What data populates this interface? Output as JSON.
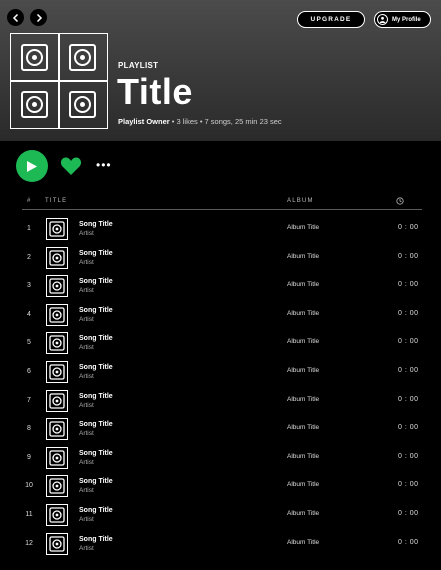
{
  "nav": {
    "back_icon": "chevron-left-icon",
    "forward_icon": "chevron-right-icon"
  },
  "top_bar": {
    "upgrade_label": "UPGRADE",
    "profile_label": "My Profile",
    "profile_icon": "user-icon"
  },
  "playlist": {
    "type_label": "PLAYLIST",
    "title": "Title",
    "owner": "Playlist Owner",
    "meta": " • 3 likes • 7 songs, 25 min 23 sec"
  },
  "controls": {
    "play_icon": "play-icon",
    "like_icon": "heart-icon",
    "more_label": "•••"
  },
  "table": {
    "headers": {
      "number": "#",
      "title": "TITLE",
      "album": "ALBUM",
      "duration_icon": "clock-icon"
    },
    "rows": [
      {
        "num": "1",
        "title": "Song Title",
        "artist": "Artist",
        "album": "Album Title",
        "duration": "0 : 00"
      },
      {
        "num": "2",
        "title": "Song Title",
        "artist": "Artist",
        "album": "Album Title",
        "duration": "0 : 00"
      },
      {
        "num": "3",
        "title": "Song Title",
        "artist": "Artist",
        "album": "Album Title",
        "duration": "0 : 00"
      },
      {
        "num": "4",
        "title": "Song Title",
        "artist": "Artist",
        "album": "Album Title",
        "duration": "0 : 00"
      },
      {
        "num": "5",
        "title": "Song Title",
        "artist": "Artist",
        "album": "Album Title",
        "duration": "0 : 00"
      },
      {
        "num": "6",
        "title": "Song Title",
        "artist": "Artist",
        "album": "Album Title",
        "duration": "0 : 00"
      },
      {
        "num": "7",
        "title": "Song Title",
        "artist": "Artist",
        "album": "Album Title",
        "duration": "0 : 00"
      },
      {
        "num": "8",
        "title": "Song Title",
        "artist": "Artist",
        "album": "Album Title",
        "duration": "0 : 00"
      },
      {
        "num": "9",
        "title": "Song Title",
        "artist": "Artist",
        "album": "Album Title",
        "duration": "0 : 00"
      },
      {
        "num": "10",
        "title": "Song Title",
        "artist": "Artist",
        "album": "Album Title",
        "duration": "0 : 00"
      },
      {
        "num": "11",
        "title": "Song Title",
        "artist": "Artist",
        "album": "Album Title",
        "duration": "0 : 00"
      },
      {
        "num": "12",
        "title": "Song Title",
        "artist": "Artist",
        "album": "Album Title",
        "duration": "0 : 00"
      }
    ]
  },
  "colors": {
    "accent": "#1db954",
    "background": "#000000",
    "header_top": "#4b4b4b",
    "header_bottom": "#2a2a2a"
  }
}
